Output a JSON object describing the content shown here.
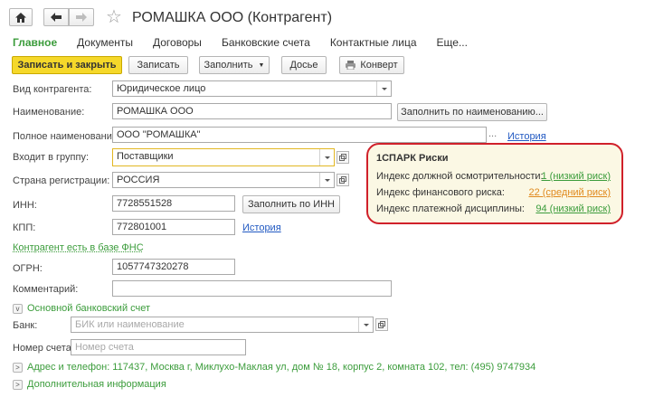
{
  "window": {
    "title": "РОМАШКА ООО (Контрагент)"
  },
  "tabs": [
    "Главное",
    "Документы",
    "Договоры",
    "Банковские счета",
    "Контактные лица",
    "Еще..."
  ],
  "toolbar": {
    "save_close": "Записать и закрыть",
    "save": "Записать",
    "fill": "Заполнить",
    "dossier": "Досье",
    "envelope": "Конверт"
  },
  "form": {
    "kind_label": "Вид контрагента:",
    "kind_value": "Юридическое лицо",
    "name_label": "Наименование:",
    "name_value": "РОМАШКА ООО",
    "fill_by_name": "Заполнить по наименованию...",
    "full_name_label": "Полное наименование:",
    "full_name_value": "ООО \"РОМАШКА\"",
    "ellipsis": "...",
    "history_link": "История",
    "group_label": "Входит в группу:",
    "group_value": "Поставщики",
    "country_label": "Страна регистрации:",
    "country_value": "РОССИЯ",
    "inn_label": "ИНН:",
    "inn_value": "7728551528",
    "fill_by_inn": "Заполнить по ИНН",
    "kpp_label": "КПП:",
    "kpp_value": "772801001",
    "kpp_history": "История",
    "fns_link": "Контрагент есть в базе ФНС",
    "ogrn_label": "ОГРН:",
    "ogrn_value": "1057747320278",
    "comment_label": "Комментарий:",
    "comment_value": ""
  },
  "bank": {
    "section": "Основной банковский счет",
    "bank_label": "Банк:",
    "bank_placeholder": "БИК или наименование",
    "account_label": "Номер счета:",
    "account_placeholder": "Номер счета"
  },
  "sections": {
    "address": "Адрес и телефон: 117437, Москва г, Миклухо-Маклая ул, дом № 18, корпус 2, комната 102, тел: (495) 9747934",
    "extra": "Дополнительная информация"
  },
  "spark": {
    "title": "1СПАРК Риски",
    "rows": [
      {
        "label": "Индекс должной осмотрительности:",
        "value": "1 (низкий риск)",
        "color": "#3b9c3b"
      },
      {
        "label": "Индекс финансового риска:",
        "value": "22 (средний риск)",
        "color": "#e08a1e"
      },
      {
        "label": "Индекс платежной дисциплины:",
        "value": "94 (низкий риск)",
        "color": "#3b9c3b"
      }
    ]
  },
  "colors": {
    "accent_green": "#3b9c3b",
    "primary_button": "#f5d82a",
    "highlight_border": "#d0202a",
    "link_blue": "#2159c2"
  }
}
